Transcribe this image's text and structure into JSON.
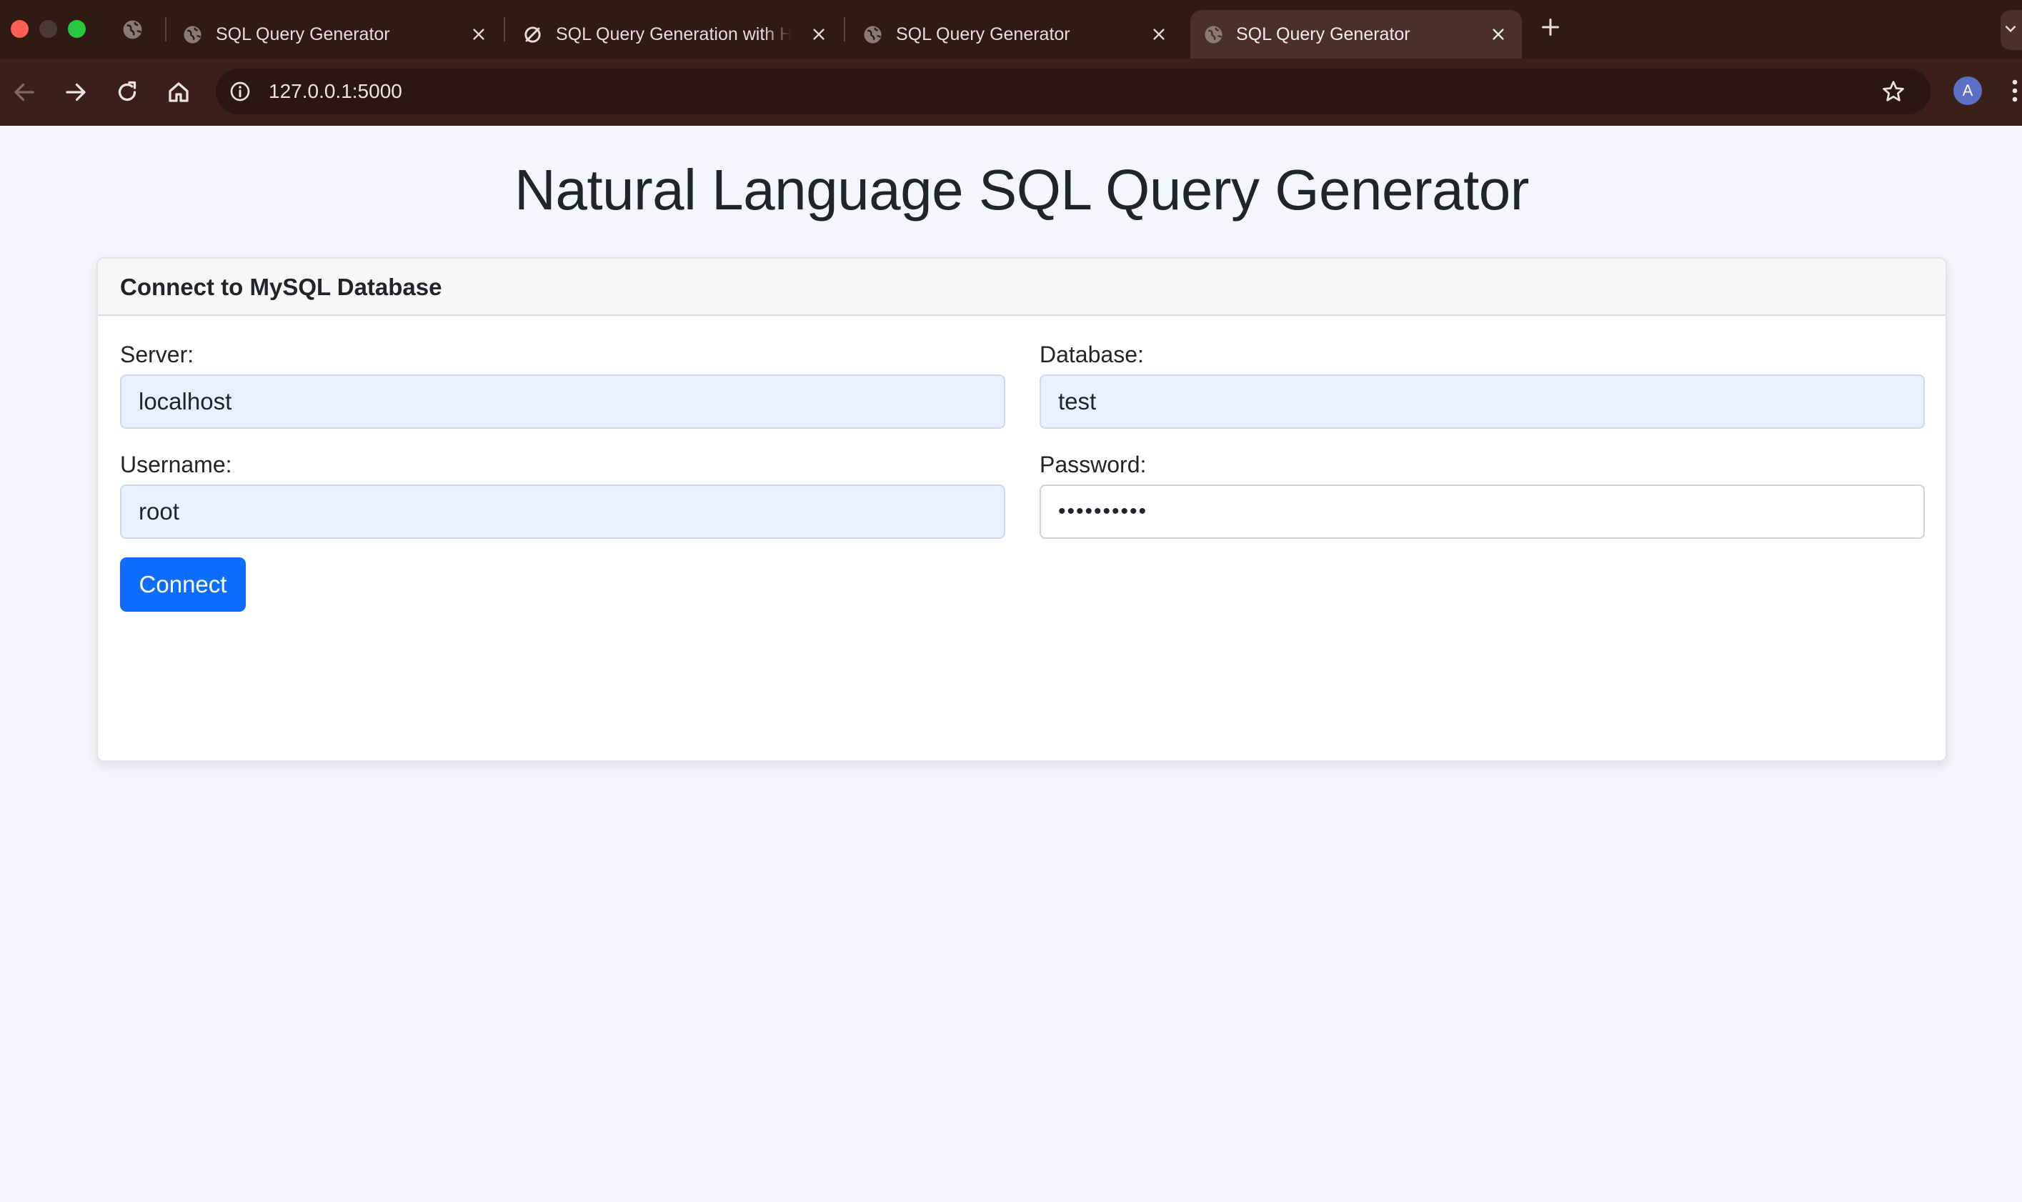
{
  "browser": {
    "tabs": [
      {
        "title": "SQL Query Generator",
        "favicon": "globe-icon",
        "active": false
      },
      {
        "title": "SQL Query Generation with H",
        "favicon": "openai-icon",
        "active": false
      },
      {
        "title": "SQL Query Generator",
        "favicon": "globe-icon",
        "active": false
      },
      {
        "title": "SQL Query Generator",
        "favicon": "globe-icon",
        "active": true
      }
    ],
    "url": "127.0.0.1:5000",
    "avatar_initial": "A"
  },
  "page": {
    "title": "Natural Language SQL Query Generator"
  },
  "connect_card": {
    "header": "Connect to MySQL Database",
    "server_label": "Server:",
    "server_value": "localhost",
    "database_label": "Database:",
    "database_value": "test",
    "username_label": "Username:",
    "username_value": "root",
    "password_label": "Password:",
    "password_value": "••••••••••",
    "connect_label": "Connect"
  },
  "colors": {
    "chrome_background": "#2f1a14",
    "toolbar_background": "#3b1f1a",
    "primary_button": "#0d6efd",
    "autofill_background": "#e8f0fe",
    "page_background": "#f4f6fa"
  }
}
